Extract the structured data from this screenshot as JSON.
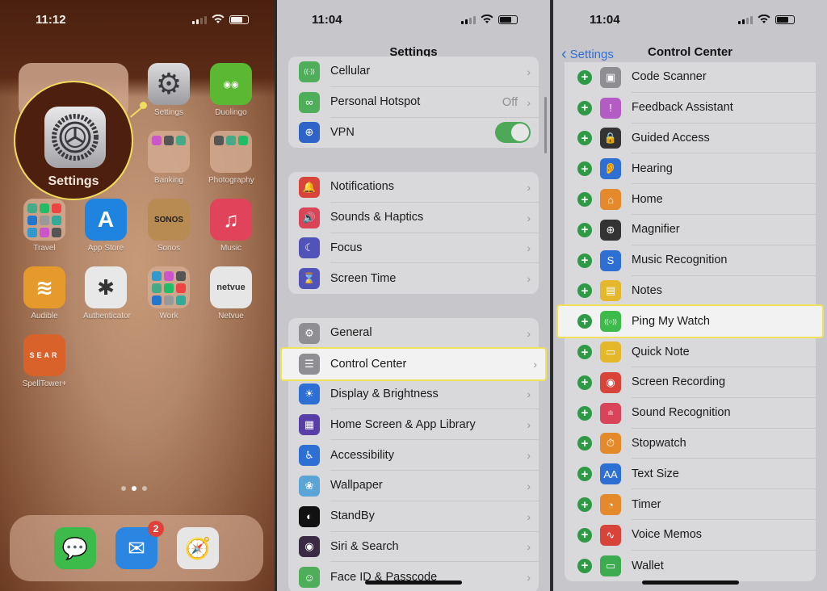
{
  "home": {
    "time": "11:12",
    "callout_label": "Settings",
    "apps": [
      {
        "name": "Settings",
        "row": 0,
        "col": 2,
        "color": "#a9a9ad",
        "glyph": "⚙"
      },
      {
        "name": "Duolingo",
        "row": 0,
        "col": 3,
        "color": "#5ab832",
        "glyph": "◉◉"
      },
      {
        "name": "Banking",
        "row": 1,
        "col": 2,
        "folder": true
      },
      {
        "name": "Photography",
        "row": 1,
        "col": 3,
        "folder": true
      },
      {
        "name": "Travel",
        "row": 2,
        "col": 0,
        "folder": true
      },
      {
        "name": "App Store",
        "row": 2,
        "col": 1,
        "color": "#1f84e0",
        "glyph": "A"
      },
      {
        "name": "Sonos",
        "row": 2,
        "col": 2,
        "color": "#b88b52",
        "glyph": "SONOS"
      },
      {
        "name": "Music",
        "row": 2,
        "col": 3,
        "color": "#e0435a",
        "glyph": "♫"
      },
      {
        "name": "Audible",
        "row": 3,
        "col": 0,
        "color": "#e59a2b",
        "glyph": "≋"
      },
      {
        "name": "Authenticator",
        "row": 3,
        "col": 1,
        "color": "#e8e8e8",
        "glyph": "✱"
      },
      {
        "name": "Work",
        "row": 3,
        "col": 2,
        "folder": true
      },
      {
        "name": "Netvue",
        "row": 3,
        "col": 3,
        "color": "#e6e6e6",
        "glyph": "netvue"
      },
      {
        "name": "SpellTower+",
        "row": 4,
        "col": 0,
        "color": "#d9622b",
        "glyph": "SEAR"
      }
    ],
    "dock": [
      {
        "name": "Messages",
        "color": "#3dbb4a",
        "glyph": "💬"
      },
      {
        "name": "Mail",
        "color": "#2a86e0",
        "glyph": "✉",
        "badge": "2"
      },
      {
        "name": "Safari",
        "color": "#e6e6e6",
        "glyph": "🧭"
      }
    ]
  },
  "settings": {
    "time": "11:04",
    "title": "Settings",
    "groups": [
      [
        {
          "label": "Cellular",
          "color": "#4fae59",
          "glyph": "((·))"
        },
        {
          "label": "Personal Hotspot",
          "color": "#4fae59",
          "glyph": "∞",
          "value": "Off"
        },
        {
          "label": "VPN",
          "color": "#2e63c7",
          "glyph": "⊕",
          "toggle": true
        }
      ],
      [
        {
          "label": "Notifications",
          "color": "#d9443a",
          "glyph": "🔔"
        },
        {
          "label": "Sounds & Haptics",
          "color": "#d94456",
          "glyph": "🔊"
        },
        {
          "label": "Focus",
          "color": "#5253b8",
          "glyph": "☾"
        },
        {
          "label": "Screen Time",
          "color": "#5253b8",
          "glyph": "⌛"
        }
      ],
      [
        {
          "label": "General",
          "color": "#8e8e93",
          "glyph": "⚙"
        },
        {
          "label": "Control Center",
          "color": "#8e8e93",
          "glyph": "☰",
          "highlighted": true
        },
        {
          "label": "Display & Brightness",
          "color": "#2e6fd3",
          "glyph": "☀"
        },
        {
          "label": "Home Screen & App Library",
          "color": "#5a3ea8",
          "glyph": "▦"
        },
        {
          "label": "Accessibility",
          "color": "#2e6fd3",
          "glyph": "♿"
        },
        {
          "label": "Wallpaper",
          "color": "#5aa4d6",
          "glyph": "❀"
        },
        {
          "label": "StandBy",
          "color": "#111111",
          "glyph": "◐"
        },
        {
          "label": "Siri & Search",
          "color": "#3a2a44",
          "glyph": "◉"
        },
        {
          "label": "Face ID & Passcode",
          "color": "#4fae59",
          "glyph": "☺"
        }
      ]
    ],
    "vpn_on": true
  },
  "control_center": {
    "time": "11:04",
    "back_label": "Settings",
    "title": "Control Center",
    "items": [
      {
        "label": "Code Scanner",
        "color": "#8e8e93",
        "glyph": "▣"
      },
      {
        "label": "Feedback Assistant",
        "color": "#b35cc4",
        "glyph": "!"
      },
      {
        "label": "Guided Access",
        "color": "#333333",
        "glyph": "🔒"
      },
      {
        "label": "Hearing",
        "color": "#2e6fd3",
        "glyph": "👂"
      },
      {
        "label": "Home",
        "color": "#e58a2b",
        "glyph": "⌂"
      },
      {
        "label": "Magnifier",
        "color": "#333333",
        "glyph": "⊕"
      },
      {
        "label": "Music Recognition",
        "color": "#2e6fd3",
        "glyph": "S"
      },
      {
        "label": "Notes",
        "color": "#e5b82b",
        "glyph": "▤"
      },
      {
        "label": "Ping My Watch",
        "color": "#3dbb4a",
        "glyph": "((○))",
        "highlighted": true
      },
      {
        "label": "Quick Note",
        "color": "#e5b82b",
        "glyph": "▭"
      },
      {
        "label": "Screen Recording",
        "color": "#d9443a",
        "glyph": "◉"
      },
      {
        "label": "Sound Recognition",
        "color": "#d9445a",
        "glyph": "ılı"
      },
      {
        "label": "Stopwatch",
        "color": "#e58a2b",
        "glyph": "⏱"
      },
      {
        "label": "Text Size",
        "color": "#2e6fd3",
        "glyph": "AA"
      },
      {
        "label": "Timer",
        "color": "#e58a2b",
        "glyph": "◔"
      },
      {
        "label": "Voice Memos",
        "color": "#d9443a",
        "glyph": "∿"
      },
      {
        "label": "Wallet",
        "color": "#3dab50",
        "glyph": "▭"
      }
    ]
  }
}
